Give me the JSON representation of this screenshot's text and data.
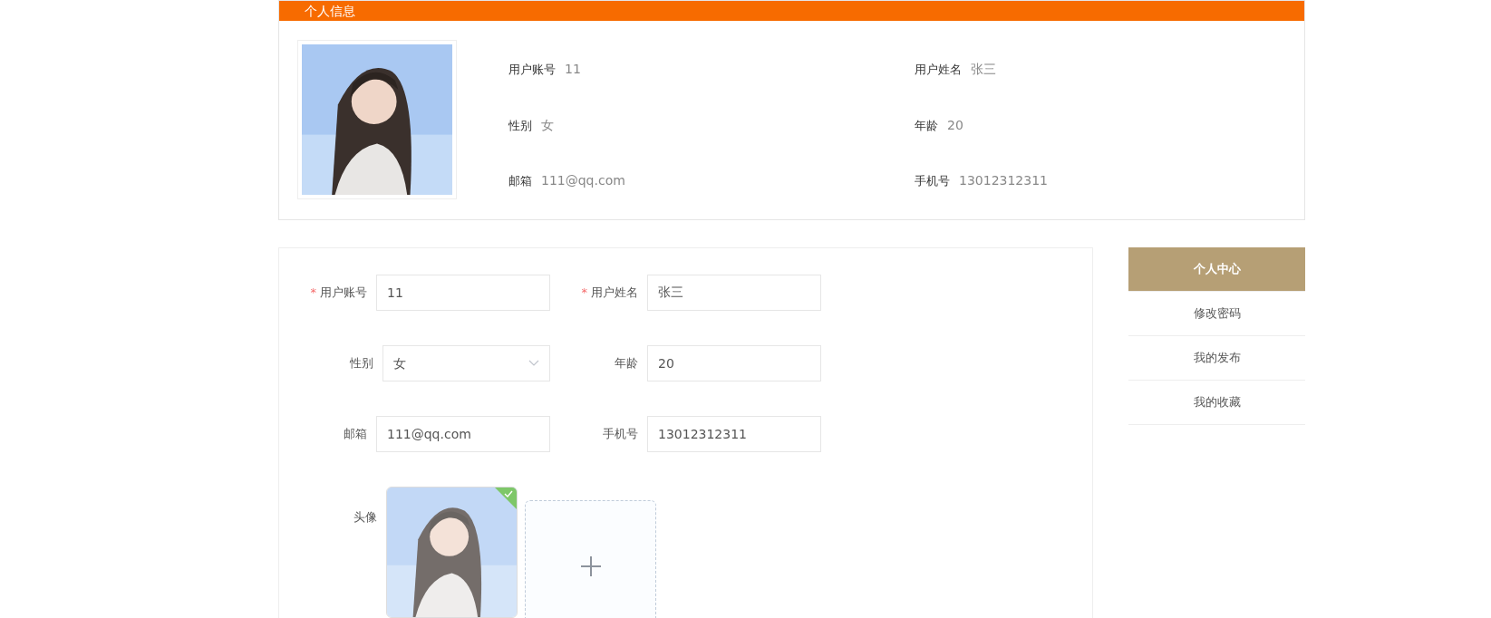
{
  "profile_card": {
    "title": "个人信息",
    "info": [
      {
        "label": "用户账号",
        "value": "11"
      },
      {
        "label": "用户姓名",
        "value": "张三"
      },
      {
        "label": "性别",
        "value": "女"
      },
      {
        "label": "年龄",
        "value": "20"
      },
      {
        "label": "邮箱",
        "value": "111@qq.com"
      },
      {
        "label": "手机号",
        "value": "13012312311"
      }
    ]
  },
  "form": {
    "rows": [
      [
        {
          "kind": "input",
          "marker": "*",
          "label": "用户账号",
          "value": "11"
        },
        {
          "kind": "input",
          "marker": "*",
          "label": "用户姓名",
          "value": "张三"
        }
      ],
      [
        {
          "kind": "select",
          "label": "性别",
          "value": "女"
        },
        {
          "kind": "input",
          "label": "年龄",
          "value": "20"
        }
      ],
      [
        {
          "kind": "input",
          "label": "邮箱",
          "value": "111@qq.com"
        },
        {
          "kind": "input",
          "label": "手机号",
          "value": "13012312311"
        }
      ],
      [
        {
          "kind": "upload",
          "label": "头像",
          "success": true
        }
      ]
    ]
  },
  "sidebar": {
    "items": [
      {
        "label": "个人中心",
        "selected": true
      },
      {
        "label": "修改密码",
        "selected": false
      },
      {
        "label": "我的发布",
        "selected": false
      },
      {
        "label": "我的收藏",
        "selected": false
      }
    ]
  }
}
